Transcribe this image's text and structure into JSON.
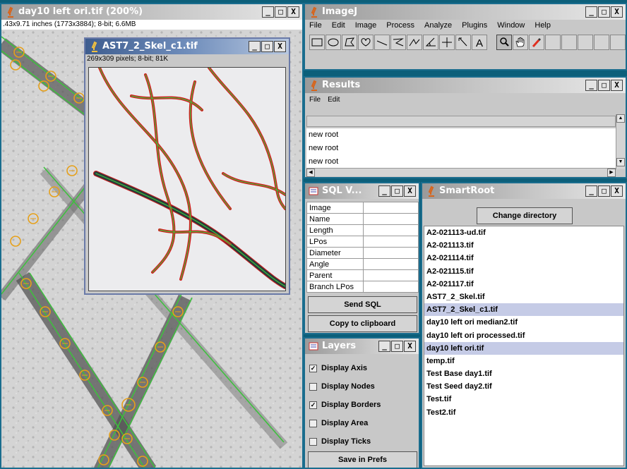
{
  "main_image_window": {
    "title": "day10 left ori.tif (200%)",
    "info": ".43x9.71 inches (1773x3884); 8-bit; 6.6MB"
  },
  "skel_window": {
    "title": "AST7_2_Skel_c1.tif",
    "info": "269x309 pixels; 8-bit; 81K"
  },
  "imagej_window": {
    "title": "ImageJ",
    "menu": [
      "File",
      "Edit",
      "Image",
      "Process",
      "Analyze",
      "Plugins",
      "Window",
      "Help"
    ],
    "tools": [
      "rectangle-tool",
      "oval-tool",
      "polygon-tool",
      "freehand-tool",
      "line-tool",
      "segmented-line-tool",
      "freehand-line-tool",
      "angle-tool",
      "point-tool",
      "wand-tool",
      "text-tool",
      "magnifier-tool",
      "hand-tool",
      "dropper-tool"
    ],
    "tool_glyphs": [
      "□",
      "◯",
      "⏢",
      "♡",
      "⟋",
      "⟨",
      "∿",
      "∡",
      "✛",
      "⤡",
      "A",
      "⌕",
      "✋",
      "✎"
    ]
  },
  "results_window": {
    "title": "Results",
    "menu": [
      "File",
      "Edit"
    ],
    "rows": [
      "new root",
      "new root",
      "new root"
    ]
  },
  "sql_window": {
    "title": "SQL V...",
    "fields": [
      "Image",
      "Name",
      "Length",
      "LPos",
      "Diameter",
      "Angle",
      "Parent",
      "Branch LPos"
    ],
    "send_button": "Send SQL",
    "clipboard_button": "Copy to clipboard"
  },
  "layers_window": {
    "title": "Layers",
    "options": [
      {
        "label": "Display Axis",
        "checked": true
      },
      {
        "label": "Display Nodes",
        "checked": false
      },
      {
        "label": "Display Borders",
        "checked": true
      },
      {
        "label": "Display Area",
        "checked": false
      },
      {
        "label": "Display Ticks",
        "checked": false
      }
    ],
    "save_button": "Save in Prefs"
  },
  "smartroot_window": {
    "title": "SmartRoot",
    "change_dir_button": "Change directory",
    "files": [
      {
        "name": "A2-021113-ud.tif",
        "highlighted": false
      },
      {
        "name": "A2-021113.tif",
        "highlighted": false
      },
      {
        "name": "A2-021114.tif",
        "highlighted": false
      },
      {
        "name": "A2-021115.tif",
        "highlighted": false
      },
      {
        "name": "A2-021117.tif",
        "highlighted": false
      },
      {
        "name": "AST7_2_Skel.tif",
        "highlighted": false
      },
      {
        "name": "AST7_2_Skel_c1.tif",
        "highlighted": true
      },
      {
        "name": "day10 left ori median2.tif",
        "highlighted": false
      },
      {
        "name": "day10 left ori processed.tif",
        "highlighted": false
      },
      {
        "name": "day10 left ori.tif",
        "highlighted": true
      },
      {
        "name": "temp.tif",
        "highlighted": false
      },
      {
        "name": "Test Base day1.tif",
        "highlighted": false
      },
      {
        "name": "Test Seed day2.tif",
        "highlighted": false
      },
      {
        "name": "Test.tif",
        "highlighted": false
      },
      {
        "name": "Test2.tif",
        "highlighted": false
      }
    ]
  },
  "window_buttons": {
    "minimize": "_",
    "maximize": "□",
    "close": "X"
  },
  "colors": {
    "frame": "#0c5f7a",
    "active_title": "#3e5d8f",
    "root_border": "#d21c1c",
    "root_axis": "#3cc23c",
    "node_marker": "#e6a019"
  }
}
